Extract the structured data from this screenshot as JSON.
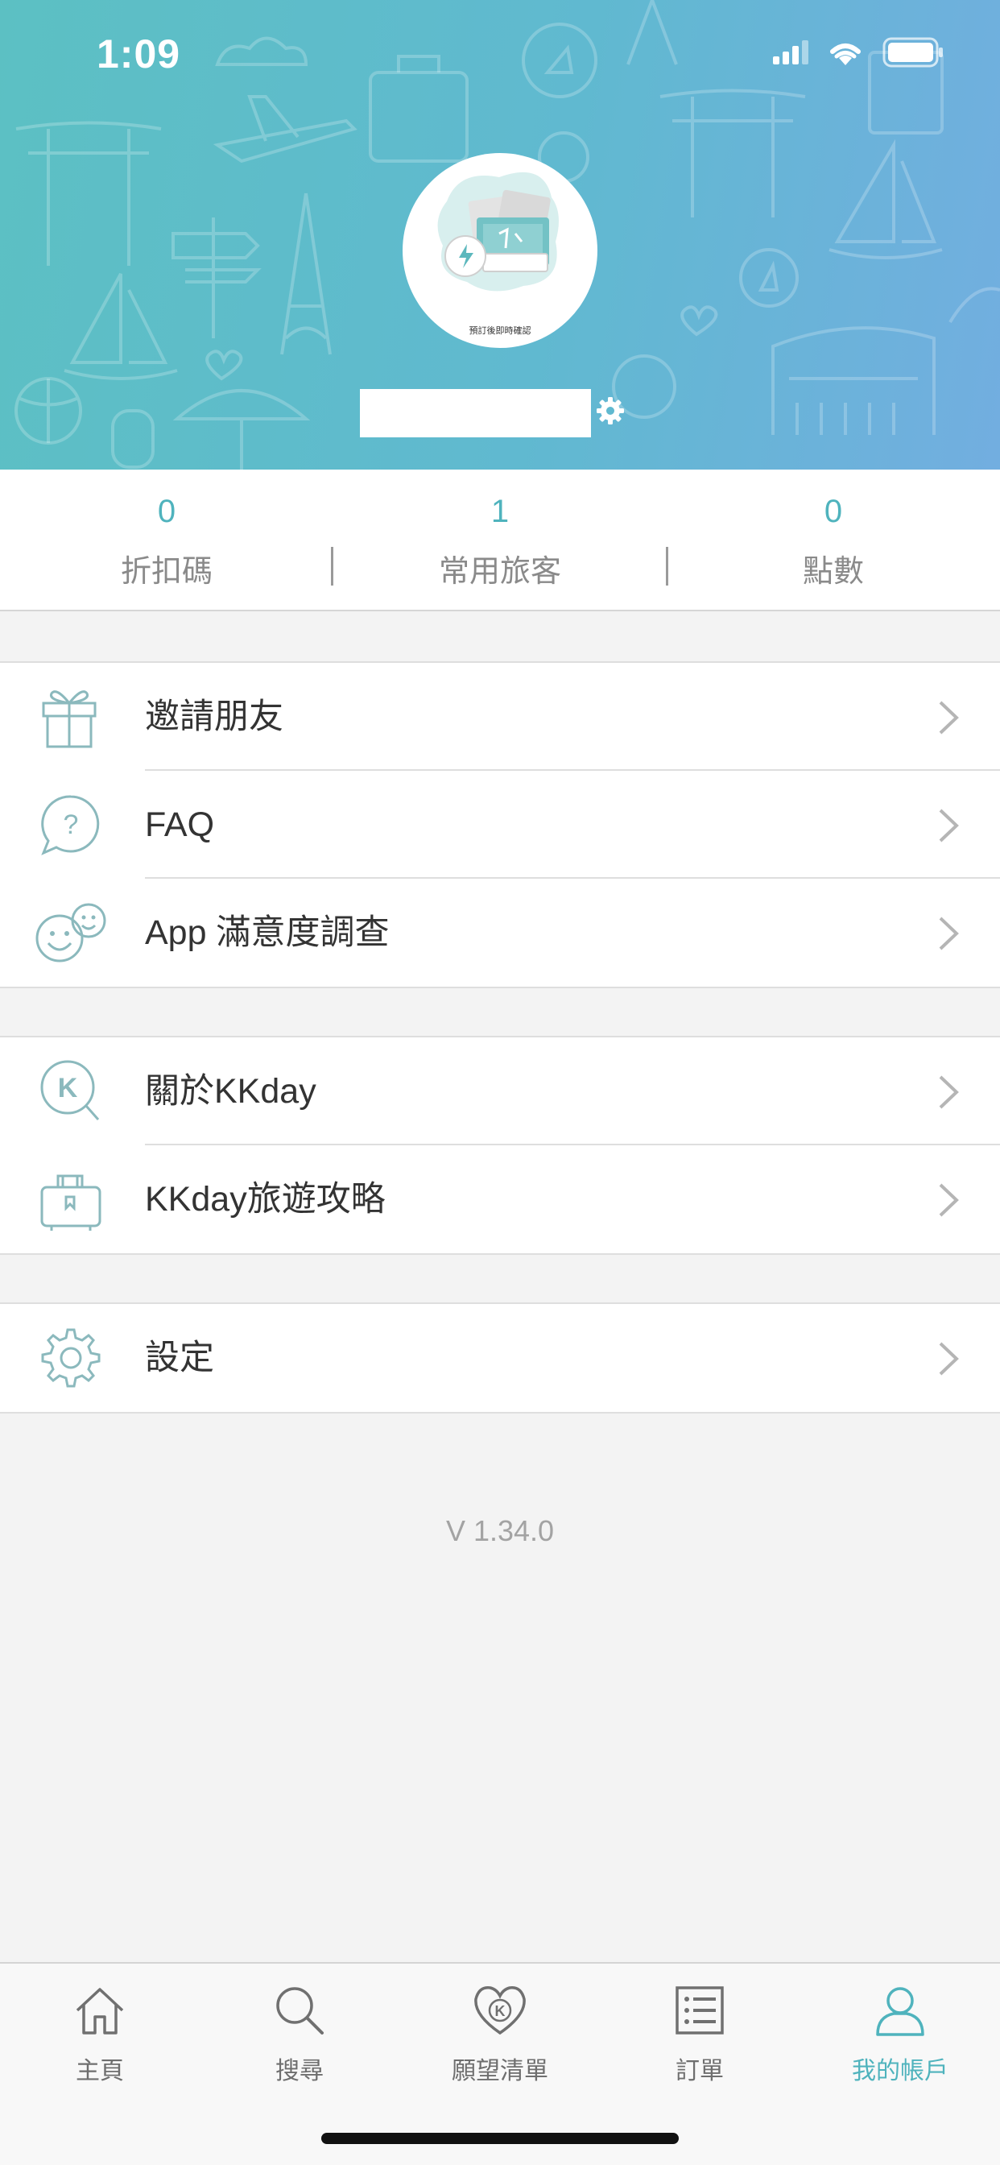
{
  "status_bar": {
    "time": "1:09"
  },
  "header": {
    "avatar_caption": "預訂後即時確認",
    "colors": {
      "gradient_start": "#5cc0c3",
      "gradient_end": "#72aee0"
    }
  },
  "stats": [
    {
      "value": "0",
      "label": "折扣碼"
    },
    {
      "value": "1",
      "label": "常用旅客"
    },
    {
      "value": "0",
      "label": "點數"
    }
  ],
  "menu_groups": [
    {
      "items": [
        {
          "icon": "gift-icon",
          "label": "邀請朋友"
        },
        {
          "icon": "question-bubble-icon",
          "label": "FAQ"
        },
        {
          "icon": "smiley-faces-icon",
          "label": "App 滿意度調查"
        }
      ]
    },
    {
      "items": [
        {
          "icon": "kkday-search-icon",
          "label": "關於KKday"
        },
        {
          "icon": "luggage-icon",
          "label": "KKday旅遊攻略"
        }
      ]
    },
    {
      "items": [
        {
          "icon": "gear-icon",
          "label": "設定"
        }
      ]
    }
  ],
  "version": "V 1.34.0",
  "tabbar": {
    "tabs": [
      {
        "icon": "home-icon",
        "label": "主頁",
        "active": false
      },
      {
        "icon": "search-icon",
        "label": "搜尋",
        "active": false
      },
      {
        "icon": "wishlist-heart-icon",
        "label": "願望清單",
        "active": false
      },
      {
        "icon": "orders-list-icon",
        "label": "訂單",
        "active": false
      },
      {
        "icon": "account-icon",
        "label": "我的帳戶",
        "active": true
      }
    ],
    "active_color": "#4fb3bd"
  }
}
